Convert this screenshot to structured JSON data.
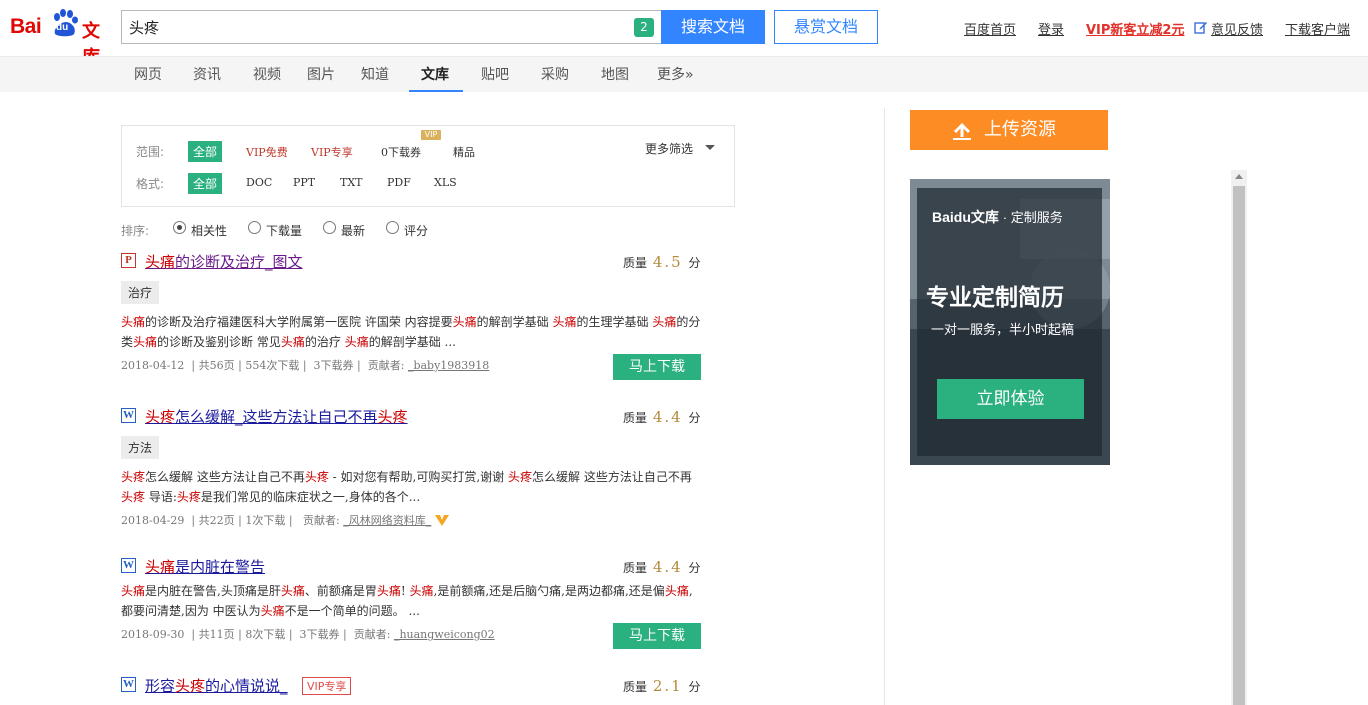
{
  "brand": {
    "logo_bai": "Bai",
    "logo_du": "du",
    "logo_wenku": "文库"
  },
  "search": {
    "query": "头疼",
    "badge": "2",
    "search_button": "搜索文档",
    "reward_button": "悬赏文档"
  },
  "top_links": {
    "home": "百度首页",
    "login": "登录",
    "vip_promo": "VIP新客立减2元",
    "feedback": "意见反馈",
    "download_client": "下载客户端"
  },
  "nav": {
    "items": [
      "网页",
      "资讯",
      "视频",
      "图片",
      "知道",
      "文库",
      "贴吧",
      "采购",
      "地图",
      "更多»"
    ],
    "active": "文库"
  },
  "filters": {
    "scope_label": "范围:",
    "scope_options": [
      "全部",
      "VIP免费",
      "VIP专享",
      "0下载券",
      "精品"
    ],
    "scope_vip_tag": "VIP",
    "format_label": "格式:",
    "format_options": [
      "全部",
      "DOC",
      "PPT",
      "TXT",
      "PDF",
      "XLS"
    ],
    "more": "更多筛选"
  },
  "sort": {
    "label": "排序:",
    "options": [
      "相关性",
      "下载量",
      "最新",
      "评分"
    ],
    "selected": "相关性"
  },
  "results": [
    {
      "type_icon": "P",
      "title_parts": [
        "头痛",
        "的诊断及治疗_图文"
      ],
      "quality_label": "质量",
      "score": "4.5",
      "score_unit": "分",
      "tag": "治疗",
      "summary": "头痛的诊断及治疗福建医科大学附属第一医院 许国荣 内容提要头痛的解剖学基础 头痛的生理学基础 头痛的分类头痛的诊断及鉴别诊断 常见头痛的治疗 头痛的解剖学基础 ...",
      "date": "2018-04-12",
      "pages": "共56页",
      "downloads": "554次下载",
      "coupon": "3下载券",
      "contributor_label": "贡献者:",
      "contributor": "_baby1983918",
      "download_button": "马上下载"
    },
    {
      "type_icon": "W",
      "title_parts": [
        "头疼",
        "怎么缓解_这些方法让自己不再",
        "头疼"
      ],
      "quality_label": "质量",
      "score": "4.4",
      "score_unit": "分",
      "tag": "方法",
      "summary": "头疼怎么缓解 这些方法让自己不再头疼 - 如对您有帮助,可购买打赏,谢谢 头疼怎么缓解 这些方法让自己不再头疼 导语:头疼是我们常见的临床症状之一,身体的各个...",
      "date": "2018-04-29",
      "pages": "共22页",
      "downloads": "1次下载",
      "contributor_label": "贡献者:",
      "contributor": "_风林网络资料库_"
    },
    {
      "type_icon": "W",
      "title_parts": [
        "头痛",
        "是内脏在警告"
      ],
      "quality_label": "质量",
      "score": "4.4",
      "score_unit": "分",
      "summary": "头痛是内脏在警告,头顶痛是肝头痛、前额痛是胃头痛! 头痛,是前额痛,还是后脑勺痛,是两边都痛,还是偏头痛,都要问清楚,因为 中医认为头痛不是一个简单的问题。 ...",
      "date": "2018-09-30",
      "pages": "共11页",
      "downloads": "8次下载",
      "coupon": "3下载券",
      "contributor_label": "贡献者:",
      "contributor": "_huangweicong02",
      "download_button": "马上下载"
    },
    {
      "type_icon": "W",
      "title_parts": [
        "形容",
        "头疼",
        "的心情说说_"
      ],
      "vip_badge": "VIP专享",
      "quality_label": "质量",
      "score": "2.1",
      "score_unit": "分"
    }
  ],
  "sidebar": {
    "upload_button": "上传资源",
    "ad": {
      "brand_main": "Baidu文库",
      "brand_sub": "· 定制服务",
      "title": "专业定制简历",
      "subtitle": "一对一服务，半小时起稿",
      "cta": "立即体验"
    }
  },
  "colors": {
    "accent_blue": "#3385ff",
    "accent_green": "#2bb07f",
    "upload_orange": "#fd8c25",
    "brand_red": "#e10602",
    "highlight_red": "#cc0000"
  }
}
